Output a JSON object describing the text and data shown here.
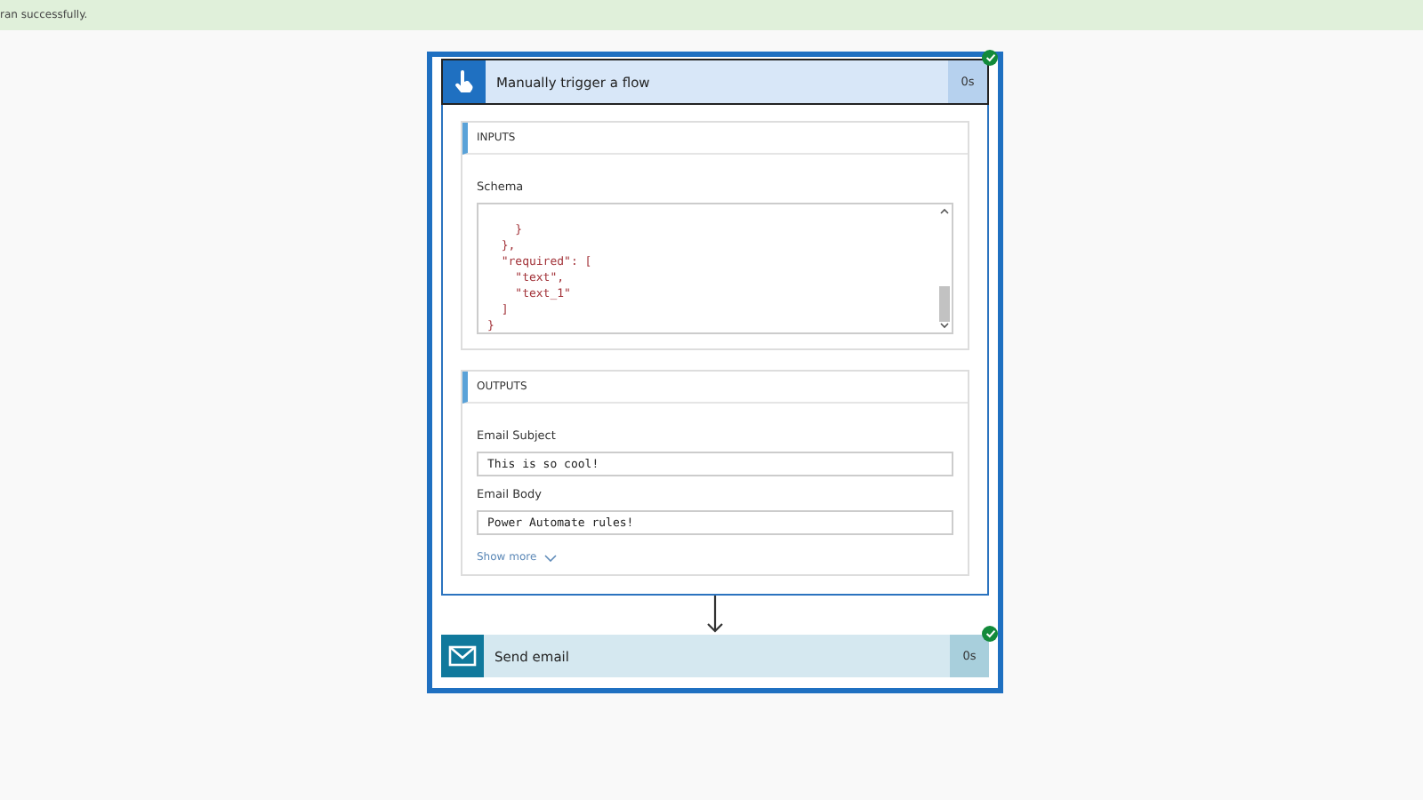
{
  "banner": {
    "message": "ran successfully."
  },
  "steps": [
    {
      "kind": "trigger",
      "title": "Manually trigger a flow",
      "duration": "0s",
      "succeeded": true,
      "expanded": true,
      "inputs": {
        "heading": "INPUTS",
        "fields": [
          {
            "label": "Schema",
            "lines": [
              "    }",
              "  },",
              "  \"required\": [",
              "    \"text\",",
              "    \"text_1\"",
              "  ]",
              "}"
            ]
          }
        ]
      },
      "outputs": {
        "heading": "OUTPUTS",
        "fields": [
          {
            "label": "Email Subject",
            "value": "This is so cool!"
          },
          {
            "label": "Email Body",
            "value": "Power Automate rules!"
          }
        ],
        "show_more": "Show more"
      }
    },
    {
      "kind": "action",
      "title": "Send email",
      "duration": "0s",
      "succeeded": true,
      "expanded": false
    }
  ]
}
